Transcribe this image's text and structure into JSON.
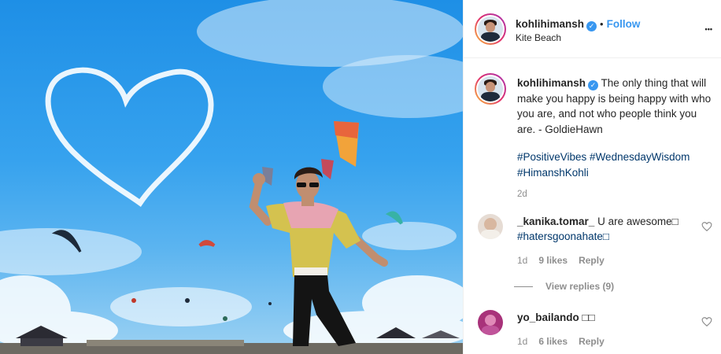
{
  "post": {
    "username": "kohlihimansh",
    "verified_glyph": "✓",
    "separator": "•",
    "follow_label": "Follow",
    "location": "Kite Beach",
    "more_label": "•••"
  },
  "caption": {
    "username": "kohlihimansh",
    "text": "The only thing that will make you happy is being happy with who you are, and not who people think you are. - GoldieHawn",
    "hashtags_line1": "#PositiveVibes #WednesdayWisdom",
    "hashtags_line2": "#HimanshKohli",
    "age": "2d"
  },
  "comments": [
    {
      "username": "_kanika.tomar_",
      "text": "U are awesome□",
      "hashtag": "#hatersgoonahate□",
      "age": "1d",
      "likes": "9 likes",
      "reply": "Reply",
      "view_replies": "View replies (9)"
    },
    {
      "username": "yo_bailando",
      "text": "□□",
      "age": "1d",
      "likes": "6 likes",
      "reply": "Reply"
    }
  ],
  "colors": {
    "accent": "#3897f0",
    "hashtag": "#00376b",
    "muted": "#8e8e8e",
    "sky": "#2f9ae9"
  },
  "icons": {
    "verified": "verified-badge-icon",
    "more": "more-options-icon",
    "like": "heart-outline-icon"
  }
}
